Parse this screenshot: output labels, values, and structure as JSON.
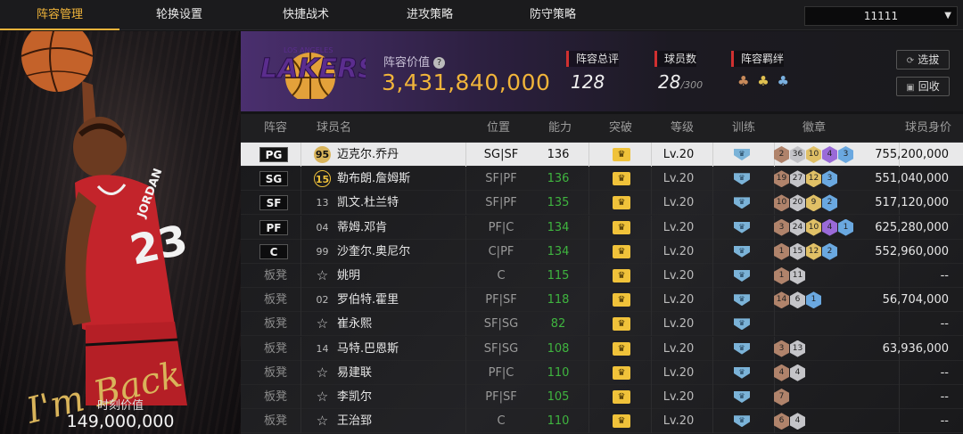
{
  "tabs": [
    "阵容管理",
    "轮换设置",
    "快捷战术",
    "进攻策略",
    "防守策略"
  ],
  "active_tab": 0,
  "server": {
    "label": "11111",
    "icon": "dropdown-caret-icon"
  },
  "hero": {
    "caption_label": "时刻价值",
    "caption_value": "149,000,000",
    "signature": "I'm Back"
  },
  "team": {
    "logo_text": "LAKERS",
    "logo_subtext": "LOS ANGELES",
    "value_label": "阵容价值",
    "value": "3,431,840,000",
    "rating_label": "阵容总评",
    "rating": "128",
    "count_label": "球员数",
    "count": "28",
    "count_max": "/300",
    "bond_label": "阵容羁绊",
    "bond_icons": [
      "bond-bronze-icon",
      "bond-gold-icon",
      "bond-blue-icon"
    ],
    "btn_select": "选拔",
    "btn_recycle": "回收"
  },
  "table": {
    "headers": [
      "阵容",
      "球员名",
      "位置",
      "能力",
      "突破",
      "等级",
      "训练",
      "徽章",
      "球员身价"
    ],
    "rows": [
      {
        "slot": "PG",
        "num": "95",
        "name": "迈克尔.乔丹",
        "pos": "SG|SF",
        "ability": "136",
        "level": "Lv.20",
        "badges": [
          "2",
          "36",
          "10",
          "4",
          "3"
        ],
        "value": "755,200,000"
      },
      {
        "slot": "SG",
        "num": "15",
        "name": "勒布朗.詹姆斯",
        "pos": "SF|PF",
        "ability": "136",
        "level": "Lv.20",
        "badges": [
          "19",
          "27",
          "12",
          "3"
        ],
        "value": "551,040,000"
      },
      {
        "slot": "SF",
        "num": "13",
        "name": "凯文.杜兰特",
        "pos": "SF|PF",
        "ability": "135",
        "level": "Lv.20",
        "badges": [
          "10",
          "20",
          "9",
          "2"
        ],
        "value": "517,120,000"
      },
      {
        "slot": "PF",
        "num": "04",
        "name": "蒂姆.邓肯",
        "pos": "PF|C",
        "ability": "134",
        "level": "Lv.20",
        "badges": [
          "3",
          "24",
          "10",
          "4",
          "1"
        ],
        "value": "625,280,000"
      },
      {
        "slot": "C",
        "num": "99",
        "name": "沙奎尔.奥尼尔",
        "pos": "C|PF",
        "ability": "134",
        "level": "Lv.20",
        "badges": [
          "1",
          "15",
          "12",
          "2"
        ],
        "value": "552,960,000"
      },
      {
        "slot": "板凳",
        "num": "☆",
        "name": "姚明",
        "pos": "C",
        "ability": "115",
        "level": "Lv.20",
        "badges": [
          "1",
          "11"
        ],
        "value": "--"
      },
      {
        "slot": "板凳",
        "num": "02",
        "name": "罗伯特.霍里",
        "pos": "PF|SF",
        "ability": "118",
        "level": "Lv.20",
        "badges": [
          "14",
          "6",
          "1"
        ],
        "value": "56,704,000"
      },
      {
        "slot": "板凳",
        "num": "☆",
        "name": "崔永熙",
        "pos": "SF|SG",
        "ability": "82",
        "level": "Lv.20",
        "badges": [],
        "value": "--"
      },
      {
        "slot": "板凳",
        "num": "14",
        "name": "马特.巴恩斯",
        "pos": "SF|SG",
        "ability": "108",
        "level": "Lv.20",
        "badges": [
          "3",
          "13"
        ],
        "value": "63,936,000"
      },
      {
        "slot": "板凳",
        "num": "☆",
        "name": "易建联",
        "pos": "PF|C",
        "ability": "110",
        "level": "Lv.20",
        "badges": [
          "4",
          "4"
        ],
        "value": "--"
      },
      {
        "slot": "板凳",
        "num": "☆",
        "name": "李凯尔",
        "pos": "PF|SF",
        "ability": "105",
        "level": "Lv.20",
        "badges": [
          "7"
        ],
        "value": "--"
      },
      {
        "slot": "板凳",
        "num": "☆",
        "name": "王治郅",
        "pos": "C",
        "ability": "110",
        "level": "Lv.20",
        "badges": [
          "6",
          "4"
        ],
        "value": "--"
      }
    ],
    "badge_tiers": [
      [
        "bronze",
        "silver",
        "gold",
        "purple",
        "blue"
      ],
      [
        "bronze",
        "silver",
        "gold",
        "blue"
      ],
      [
        "bronze",
        "silver",
        "gold",
        "blue"
      ],
      [
        "bronze",
        "silver",
        "gold",
        "purple",
        "blue"
      ],
      [
        "bronze",
        "silver",
        "gold",
        "blue"
      ],
      [
        "bronze",
        "silver"
      ],
      [
        "bronze",
        "silver",
        "blue"
      ],
      [],
      [
        "bronze",
        "silver"
      ],
      [
        "bronze",
        "silver"
      ],
      [
        "bronze"
      ],
      [
        "bronze",
        "silver"
      ]
    ]
  },
  "colors": {
    "accent": "#f0b43a",
    "ability_green": "#3fb43f",
    "selected_row": "#e9e9ea"
  }
}
